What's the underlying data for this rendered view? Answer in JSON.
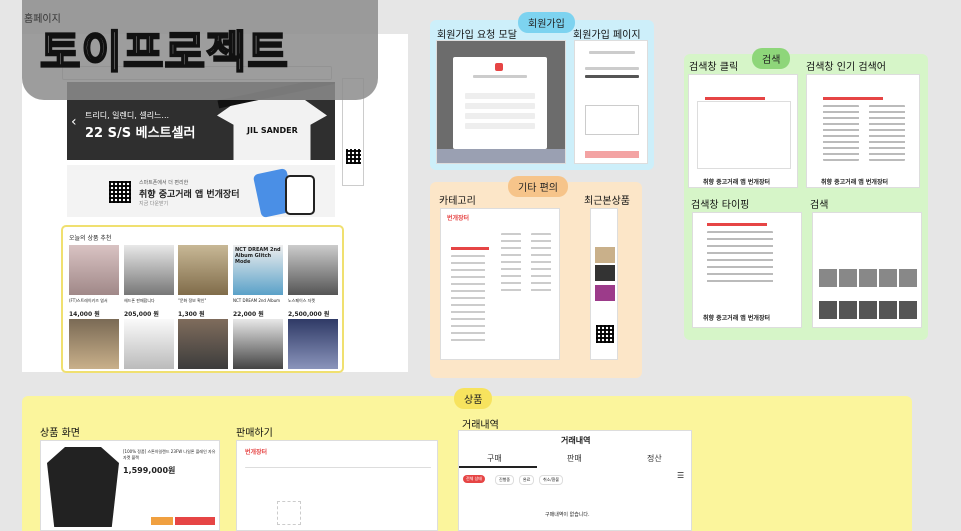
{
  "title": "토이프로젝트",
  "home": {
    "label": "홈페이지",
    "banner_line1": "트리디, 일렌디, 셀리느...",
    "banner_line2": "22 S/S 베스트셀러",
    "shirt_brand": "JIL SANDER",
    "app_banner_small": "스마트폰에서 더 편리한",
    "app_banner_big": "취향 중고거래 앱 번개장터",
    "app_banner_sub": "지금 다운받기",
    "recommend_title": "오늘의 상품 추천",
    "products": [
      {
        "name": "(FT)스트레이키즈 엽서",
        "price": "14,000 원"
      },
      {
        "name": "헤드폰 판매합니다",
        "price": "205,000 원"
      },
      {
        "name": "\"문화 정보 확인\"",
        "price": "1,300 원"
      },
      {
        "name": "NCT DREAM 2nd Album",
        "price": "22,000 원"
      },
      {
        "name": "노스페이스 자켓",
        "price": "2,500,000 원"
      }
    ],
    "album_text": "NCT DREAM 2nd Album Glitch Mode"
  },
  "signup": {
    "tag": "회원가입",
    "modal_label": "회원가입 요청 모달",
    "page_label": "회원가입 페이지"
  },
  "etc": {
    "tag": "기타 편의",
    "category_label": "카테고리",
    "recent_label": "최근본상품",
    "brand": "번개장터"
  },
  "search": {
    "tag": "검색",
    "click_label": "검색창 클릭",
    "popular_label": "검색창 인기 검색어",
    "typing_label": "검색창 타이핑",
    "result_label": "검색",
    "app_banner": "취향 중고거래 앱 번개장터"
  },
  "product": {
    "tag": "상품",
    "screen_label": "상품 화면",
    "sell_label": "판매하기",
    "history_label": "거래내역",
    "product_title": "[100% 정품] 스톤아일랜드 23FW 나일론 플레인 자유 자켓 블랙",
    "product_price": "1,599,000원",
    "sell_brand": "번개장터",
    "history_title": "거래내역",
    "history_tabs": [
      "구매",
      "판매",
      "정산"
    ],
    "history_filters": [
      "전체 상태",
      "진행중",
      "완료",
      "취소/환불"
    ],
    "history_empty": "구매내역이 없습니다."
  },
  "colors": {
    "blue_panel": "#cdeffa",
    "orange_panel": "#fce6c8",
    "green_panel": "#d6f5c8",
    "yellow_panel": "#fbf59c",
    "accent_red": "#e64545"
  }
}
